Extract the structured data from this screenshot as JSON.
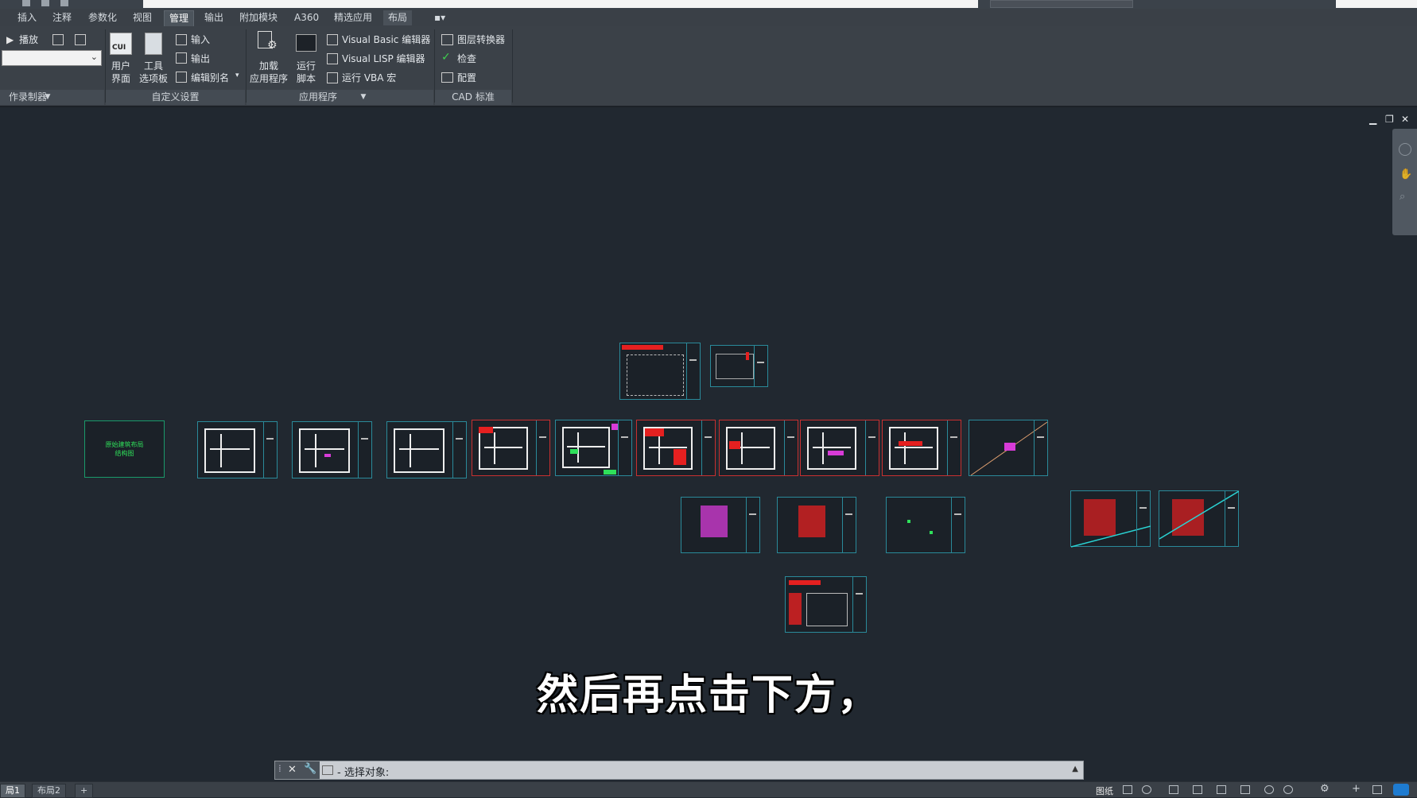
{
  "menu": {
    "tabs": [
      "插入",
      "注释",
      "参数化",
      "视图",
      "管理",
      "输出",
      "附加模块",
      "A360",
      "精选应用",
      "布局"
    ],
    "active_tab": "管理"
  },
  "ribbon": {
    "action_recorder": {
      "play_label": "播放",
      "panel_title": "作录制器"
    },
    "customize": {
      "user_interface_label": "用户\n界面",
      "user_interface_badge": "CUI",
      "tool_palettes_label": "工具\n选项板",
      "import_label": "输入",
      "export_label": "输出",
      "edit_alias_label": "编辑别名",
      "panel_title": "自定义设置"
    },
    "applications": {
      "load_app_label": "加载\n应用程序",
      "run_script_label": "运行\n脚本",
      "vb_editor_label": "Visual Basic 编辑器",
      "lisp_editor_label": "Visual LISP 编辑器",
      "run_vba_label": "运行 VBA 宏",
      "panel_title": "应用程序"
    },
    "cad_standards": {
      "layer_translator_label": "图层转换器",
      "check_label": "检查",
      "configure_label": "配置",
      "panel_title": "CAD 标准"
    }
  },
  "drawing": {
    "title_sheet_text": "原始建筑布局\n结构图"
  },
  "subtitle": "然后再点击下方，",
  "command_line": {
    "prompt": "- 选择对象:"
  },
  "layout_tabs": [
    "局1",
    "布局2",
    "+"
  ],
  "status": {
    "paper_label": "图纸"
  },
  "colors": {
    "background": "#212830",
    "sheet_border": "#2a8a9a",
    "accent_red": "#e52020",
    "accent_magenta": "#d83bd8",
    "accent_green": "#2fe05a"
  }
}
